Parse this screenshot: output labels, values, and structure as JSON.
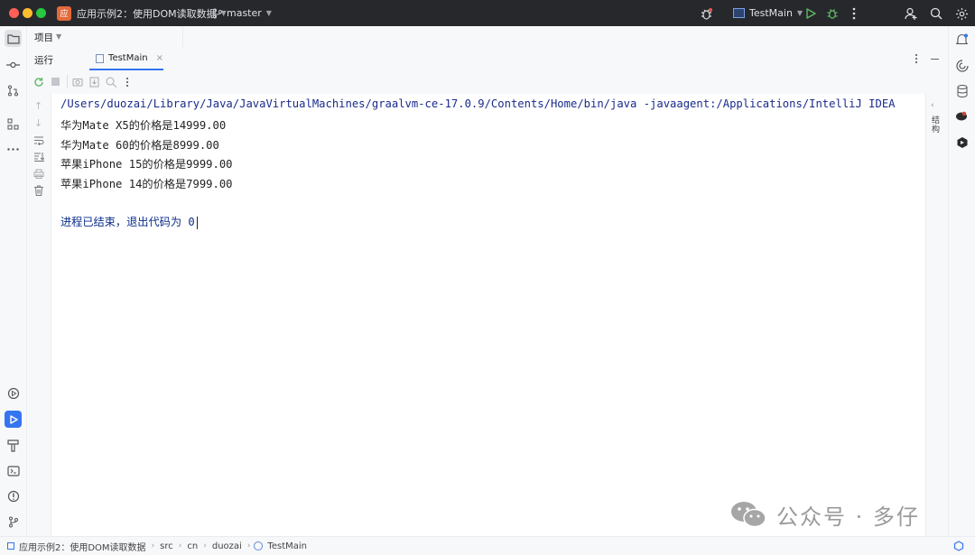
{
  "titlebar": {
    "project_badge": "应",
    "project_name": "应用示例2：使用DOM读取数据",
    "branch": "master",
    "run_config": "TestMain"
  },
  "project_panel": {
    "title": "项目"
  },
  "run_panel": {
    "label": "运行",
    "tab_label": "TestMain"
  },
  "console": {
    "command": "/Users/duozai/Library/Java/JavaVirtualMachines/graalvm-ce-17.0.9/Contents/Home/bin/java -javaagent:/Applications/IntelliJ IDEA",
    "lines": [
      "华为Mate X5的价格是14999.00",
      "华为Mate 60的价格是8999.00",
      "苹果iPhone 15的价格是9999.00",
      "苹果iPhone 14的价格是7999.00"
    ],
    "exit_message": "进程已结束，退出代码为 0"
  },
  "right_panel": {
    "label": "结构"
  },
  "statusbar": {
    "crumbs": [
      "应用示例2：使用DOM读取数据",
      "src",
      "cn",
      "duozai",
      "TestMain"
    ]
  },
  "watermark": {
    "text": "公众号 · 多仔"
  },
  "colors": {
    "accent": "#3574f0",
    "titlebar_bg": "#27282c",
    "badge": "#e36a3c"
  }
}
